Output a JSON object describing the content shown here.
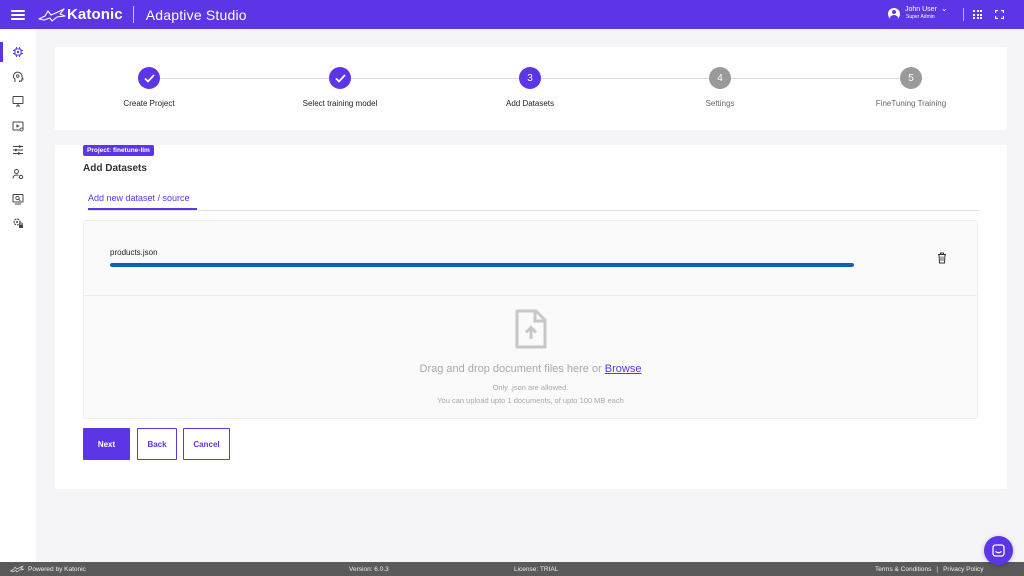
{
  "header": {
    "brand": "Katonic",
    "app_title": "Adaptive Studio",
    "user_name": "John User",
    "user_role": "Super Admin"
  },
  "sidebar": {
    "items": [
      {
        "icon": "chip-icon",
        "active": true
      },
      {
        "icon": "brain-icon",
        "active": false
      },
      {
        "icon": "monitor-icon",
        "active": false
      },
      {
        "icon": "video-settings-icon",
        "active": false
      },
      {
        "icon": "sliders-icon",
        "active": false
      },
      {
        "icon": "user-settings-icon",
        "active": false
      },
      {
        "icon": "screen-search-icon",
        "active": false
      },
      {
        "icon": "gear-lock-icon",
        "active": false
      }
    ]
  },
  "stepper": {
    "steps": [
      {
        "label": "Create Project",
        "number": "1",
        "status": "done"
      },
      {
        "label": "Select training model",
        "number": "2",
        "status": "done"
      },
      {
        "label": "Add Datasets",
        "number": "3",
        "status": "current"
      },
      {
        "label": "Settings",
        "number": "4",
        "status": "pending"
      },
      {
        "label": "FineTuning Training",
        "number": "5",
        "status": "pending"
      }
    ]
  },
  "content": {
    "project_badge": "Project: finetune-llm",
    "section_title": "Add Datasets",
    "tab_label": "Add new dataset / source",
    "file": {
      "name": "products.json",
      "progress": 1.0
    },
    "drop_zone": {
      "text": "Drag and drop document files here or",
      "browse_label": "Browse",
      "hint_allowed": "Only .json are allowed.",
      "hint_limit": "You can upload upto 1 documents, of upto 100 MB each"
    },
    "buttons": {
      "next": "Next",
      "back": "Back",
      "cancel": "Cancel"
    }
  },
  "footer": {
    "powered_by": "Powered by Katonic",
    "version": "Version: 6.0.3",
    "license": "License: TRIAL",
    "terms": "Terms & Conditions",
    "separator": "|",
    "privacy": "Privacy Policy"
  },
  "colors": {
    "accent": "#5b35e6",
    "progress": "#0b62b0",
    "pending_step": "#9a9a9a",
    "footer_bg": "#5a5a5a"
  }
}
